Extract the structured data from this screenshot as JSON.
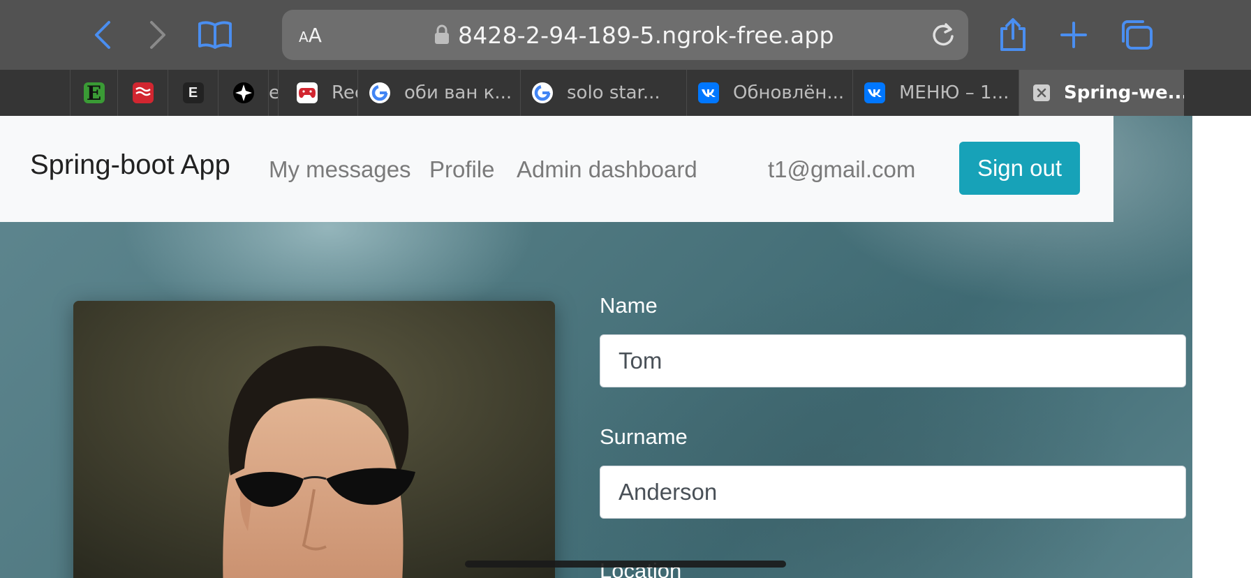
{
  "browser": {
    "url": "8428-2-94-189-5.ngrok-free.app",
    "reader_text_small": "A",
    "reader_text_big": "A",
    "tabs": [
      {
        "title": "",
        "icon": "e-green-favicon"
      },
      {
        "title": "",
        "icon": "red-wave-favicon"
      },
      {
        "title": "",
        "icon": "e-dark-favicon",
        "letter": "E"
      },
      {
        "title": "",
        "icon": "compass-star-favicon"
      },
      {
        "title": "e",
        "icon": "truncated-tab"
      },
      {
        "title": "Rec",
        "icon": "gamepad-favicon"
      },
      {
        "title": "оби ван к...",
        "icon": "google-favicon"
      },
      {
        "title": "solo star...",
        "icon": "google-favicon"
      },
      {
        "title": "Обновлён...",
        "icon": "vk-favicon"
      },
      {
        "title": "МЕНЮ – 1...",
        "icon": "vk-favicon"
      },
      {
        "title": "Spring-we...",
        "icon": "close-icon"
      }
    ]
  },
  "navbar": {
    "brand": "Spring-boot App",
    "links": [
      "My messages",
      "Profile",
      "Admin dashboard"
    ],
    "email": "t1@gmail.com",
    "signout": "Sign out"
  },
  "profile": {
    "name_label": "Name",
    "name_value": "Tom",
    "surname_label": "Surname",
    "surname_value": "Anderson",
    "location_label": "Location"
  },
  "colors": {
    "accent": "#17a2b8",
    "toolbar_blue": "#4a8ef0"
  }
}
